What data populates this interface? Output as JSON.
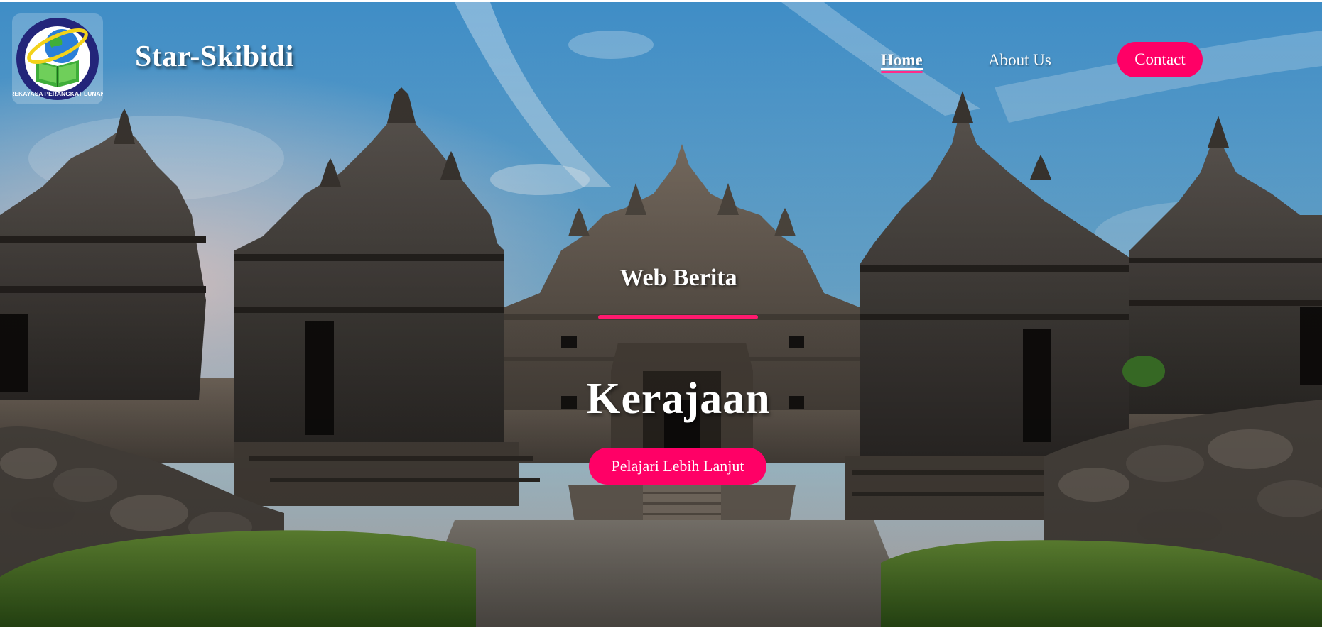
{
  "brand": {
    "name": "Star-Skibidi",
    "logo_text": "REKAYASA PERANGKAT LUNAK",
    "logo_icon": "globe-book-icon"
  },
  "nav": {
    "items": [
      {
        "label": "Home",
        "active": true
      },
      {
        "label": "About Us",
        "active": false
      },
      {
        "label": "Contact",
        "active": false
      }
    ]
  },
  "hero": {
    "subtitle": "Web Berita",
    "headline": "Kerajaan",
    "cta_label": "Pelajari Lebih Lanjut"
  },
  "colors": {
    "accent": "#ff0066",
    "text": "#ffffff"
  }
}
